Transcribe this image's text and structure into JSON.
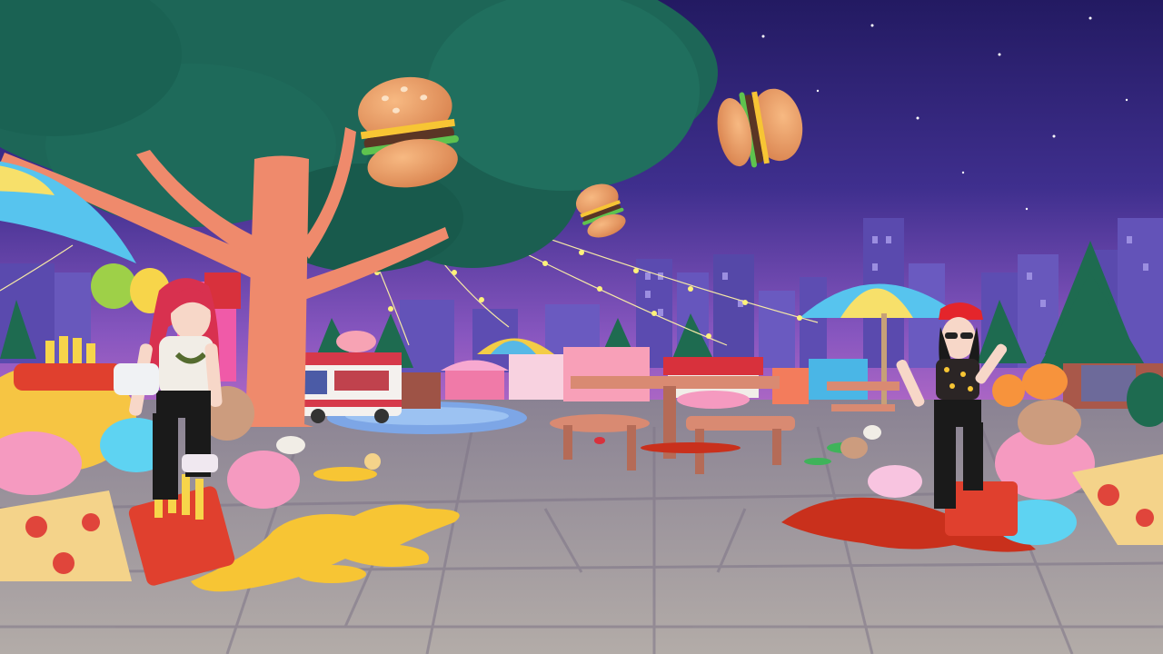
{
  "scene": {
    "setting": "night-food-festival-plaza",
    "colors": {
      "sky_top": "#2a1f6e",
      "sky_mid": "#4a3796",
      "sky_horizon": "#a765c8",
      "tree_canopy": "#1f6e5e",
      "tree_trunk": "#f08a6e",
      "pavement": "#a9a0a0",
      "lights": "#fff27a",
      "ketchup": "#d2301e",
      "mustard": "#f7c534"
    },
    "food_truck_sign": "",
    "characters": [
      "player-avatar-left",
      "player-avatar-right"
    ],
    "floating_items": [
      "burger-icon",
      "burger-icon",
      "burger-icon"
    ]
  }
}
